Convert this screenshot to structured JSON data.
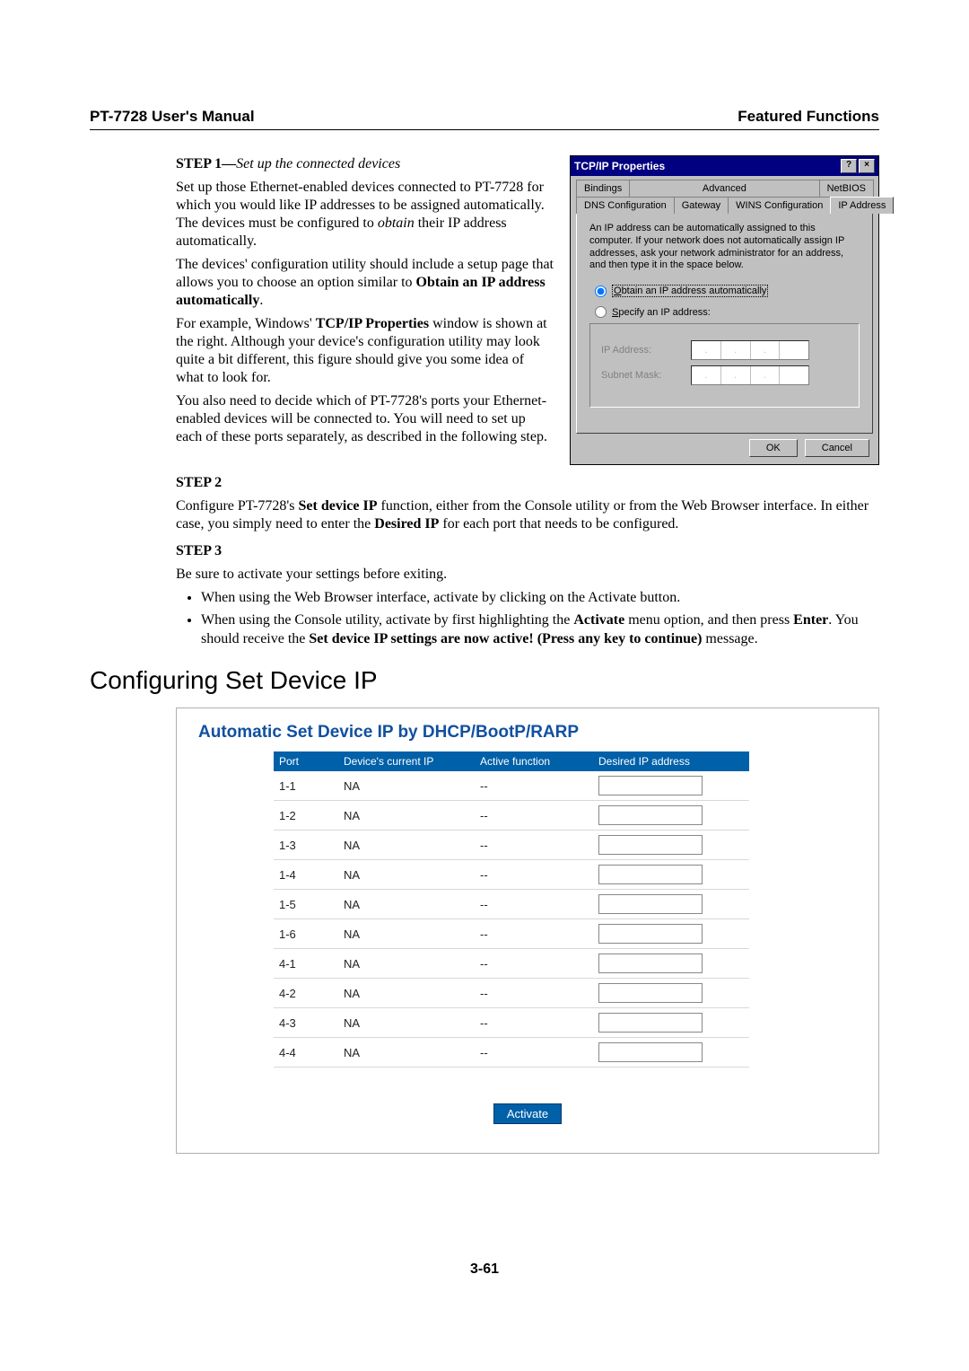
{
  "header": {
    "left": "PT-7728 User's Manual",
    "right": "Featured Functions"
  },
  "step1": {
    "heading_prefix": "STEP 1—",
    "heading_italic": "Set up the connected devices",
    "p1a": "Set up those Ethernet-enabled devices connected to PT-7728 for which you would like IP addresses to be assigned automatically. The devices must be configured to ",
    "p1_obtain": "obtain",
    "p1b": " their IP address automatically.",
    "p2a": "The devices' configuration utility should include a setup page that allows you to choose an option similar to ",
    "p2_bold": "Obtain an IP address automatically",
    "p2b": ".",
    "p3a": "For example, Windows' ",
    "p3_bold": "TCP/IP Properties",
    "p3b": " window is shown at the right. Although your device's configuration utility may look quite a bit different, this figure should give you some idea of what to look for.",
    "p4": "You also need to decide which of PT-7728's ports your Ethernet-enabled devices will be connected to. You will need to set up each of these ports separately, as described in the following step."
  },
  "dialog": {
    "title": "TCP/IP Properties",
    "help_btn": "?",
    "close_btn": "×",
    "tabs_row1": [
      "Bindings",
      "Advanced",
      "NetBIOS"
    ],
    "tabs_row2": [
      "DNS Configuration",
      "Gateway",
      "WINS Configuration",
      "IP Address"
    ],
    "desc": "An IP address can be automatically assigned to this computer. If your network does not automatically assign IP addresses, ask your network administrator for an address, and then type it in the space below.",
    "radio_obtain_u": "O",
    "radio_obtain_rest": "btain an IP address automatically",
    "radio_specify_u": "S",
    "radio_specify_rest": "pecify an IP address:",
    "ip_label": "IP Address:",
    "mask_label": "Subnet Mask:",
    "ok": "OK",
    "cancel": "Cancel"
  },
  "step2": {
    "heading": "STEP 2",
    "a": "Configure PT-7728's ",
    "bold1": "Set device IP",
    "b": " function, either from the Console utility or from the Web Browser interface. In either case, you simply need to enter the ",
    "bold2": "Desired IP",
    "c": " for each port that needs to be configured."
  },
  "step3": {
    "heading": "STEP 3",
    "p": "Be sure to activate your settings before exiting.",
    "li1": "When using the Web Browser interface, activate by clicking on the Activate button.",
    "li2a": "When using the Console utility, activate by first highlighting the ",
    "li2b1": "Activate",
    "li2c": " menu option, and then press ",
    "li2b2": "Enter",
    "li2d": ". You should receive the ",
    "li2b3": "Set device IP settings are now active! (Press any key to continue)",
    "li2e": " message."
  },
  "section_title": "Configuring Set Device IP",
  "panel": {
    "title": "Automatic Set Device IP by DHCP/BootP/RARP",
    "headers": {
      "port": "Port",
      "cur": "Device's current IP",
      "act": "Active function",
      "des": "Desired IP address"
    },
    "rows": [
      {
        "port": "1-1",
        "cur": "NA",
        "act": "--"
      },
      {
        "port": "1-2",
        "cur": "NA",
        "act": "--"
      },
      {
        "port": "1-3",
        "cur": "NA",
        "act": "--"
      },
      {
        "port": "1-4",
        "cur": "NA",
        "act": "--"
      },
      {
        "port": "1-5",
        "cur": "NA",
        "act": "--"
      },
      {
        "port": "1-6",
        "cur": "NA",
        "act": "--"
      },
      {
        "port": "4-1",
        "cur": "NA",
        "act": "--"
      },
      {
        "port": "4-2",
        "cur": "NA",
        "act": "--"
      },
      {
        "port": "4-3",
        "cur": "NA",
        "act": "--"
      },
      {
        "port": "4-4",
        "cur": "NA",
        "act": "--"
      }
    ],
    "activate": "Activate"
  },
  "page_num": "3-61"
}
